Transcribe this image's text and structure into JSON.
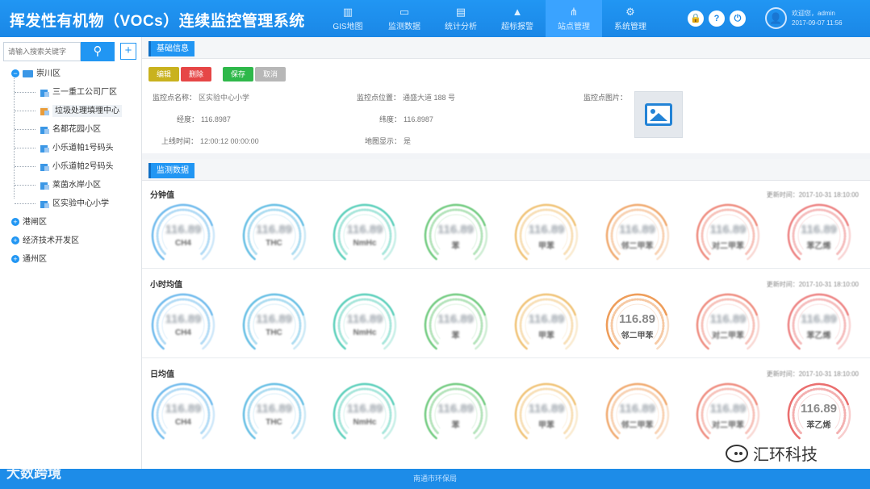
{
  "header": {
    "app_title": "挥发性有机物（VOCs）连续监控管理系统",
    "nav": [
      {
        "label": "GIS地图",
        "icon": "map-icon",
        "glyph": "▥"
      },
      {
        "label": "监测数据",
        "icon": "monitor-icon",
        "glyph": "▭"
      },
      {
        "label": "统计分析",
        "icon": "chart-icon",
        "glyph": "▤"
      },
      {
        "label": "超标报警",
        "icon": "alarm-icon",
        "glyph": "▲"
      },
      {
        "label": "站点管理",
        "icon": "sitemap-icon",
        "glyph": "⋔"
      },
      {
        "label": "系统管理",
        "icon": "gears-icon",
        "glyph": "⚙"
      }
    ],
    "active_nav": 4,
    "icons": [
      {
        "name": "lock-icon",
        "glyph": "🔒"
      },
      {
        "name": "help-icon",
        "glyph": "?"
      },
      {
        "name": "power-icon",
        "glyph": "⏻"
      }
    ],
    "user": {
      "greeting": "欢迎您，admin",
      "datetime": "2017-09-07 11:56",
      "avatar_glyph": "👤"
    }
  },
  "sidebar": {
    "search": {
      "placeholder": "请输入搜索关键字",
      "button_glyph": "⚲",
      "add_glyph": "+"
    },
    "tree": [
      {
        "label": "崇川区",
        "expanded": true,
        "children": [
          {
            "label": "三一重工公司厂区",
            "selected": false
          },
          {
            "label": "垃圾处理填埋中心",
            "selected": true
          },
          {
            "label": "名都花园小区",
            "selected": false
          },
          {
            "label": "小乐道帕1号码头",
            "selected": false
          },
          {
            "label": "小乐道帕2号码头",
            "selected": false
          },
          {
            "label": "莱茵水岸小区",
            "selected": false
          },
          {
            "label": "区实验中心小学",
            "selected": false
          }
        ]
      },
      {
        "label": "港闸区",
        "expanded": false,
        "children": []
      },
      {
        "label": "经济技术开发区",
        "expanded": false,
        "children": []
      },
      {
        "label": "通州区",
        "expanded": false,
        "children": []
      }
    ]
  },
  "basic_info": {
    "title": "基础信息",
    "buttons": [
      {
        "label": "编辑",
        "color": "#c9b21e"
      },
      {
        "label": "删除",
        "color": "#e64646"
      },
      {
        "label": "保存",
        "color": "#2eb84a"
      },
      {
        "label": "取消",
        "color": "#b7b7b7"
      }
    ],
    "fields": {
      "name_label": "监控点名称：",
      "name_value": "区实验中心小学",
      "location_label": "监控点位置：",
      "location_value": "通盛大道 188 号",
      "photo_label": "监控点图片：",
      "lng_label": "经度：",
      "lng_value": "116.8987",
      "lat_label": "纬度：",
      "lat_value": "116.8987",
      "online_label": "上线时间：",
      "online_value": "12:00:12 00:00:00",
      "map_label": "地图显示：",
      "map_value": "是"
    }
  },
  "monitor": {
    "title": "监测数据",
    "rows": [
      {
        "title": "分钟值",
        "updated": "更新时间：2017-10-31 18:10:00",
        "clear": []
      },
      {
        "title": "小时均值",
        "updated": "更新时间：2017-10-31 18:10:00",
        "clear": [
          5
        ]
      },
      {
        "title": "日均值",
        "updated": "更新时间：2017-10-31 18:10:00",
        "clear": [
          7
        ]
      }
    ],
    "gauges": [
      {
        "label": "CH4",
        "value": "116.89",
        "color": "#5ab0ea"
      },
      {
        "label": "THC",
        "value": "116.89",
        "color": "#4fb5e0"
      },
      {
        "label": "NmHc",
        "value": "116.89",
        "color": "#42c8b0"
      },
      {
        "label": "苯",
        "value": "116.89",
        "color": "#5cc36c"
      },
      {
        "label": "甲苯",
        "value": "116.89",
        "color": "#eeba62"
      },
      {
        "label": "邻二甲苯",
        "value": "116.89",
        "color": "#ee9d5a"
      },
      {
        "label": "对二甲苯",
        "value": "116.89",
        "color": "#ec7b6c"
      },
      {
        "label": "苯乙烯",
        "value": "116.89",
        "color": "#ea6f6f"
      }
    ]
  },
  "footer": {
    "text": "南通市环保局"
  },
  "watermarks": {
    "left": "大数跨境",
    "right": "汇环科技"
  }
}
